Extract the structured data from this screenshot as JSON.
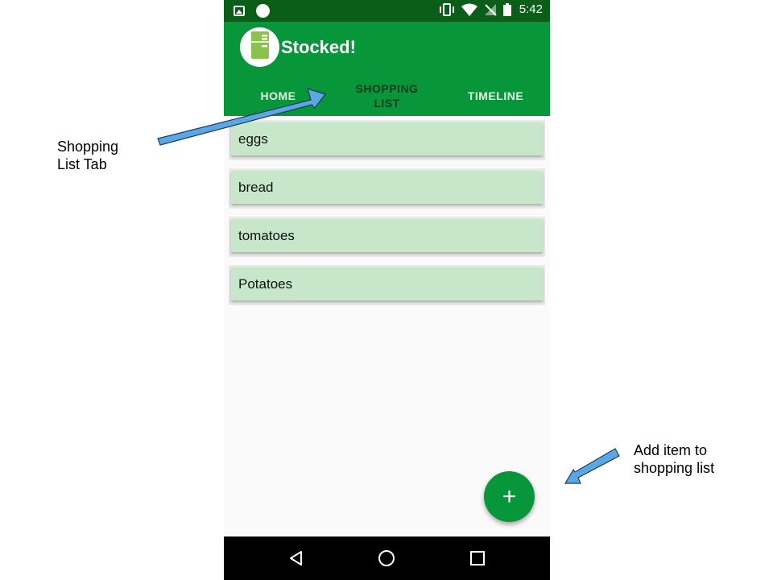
{
  "status_bar": {
    "time": "5:42",
    "left_icons": [
      "image-icon",
      "circle-icon"
    ],
    "right_icons": [
      "vibrate-icon",
      "wifi-icon",
      "no-signal-icon",
      "battery-icon"
    ]
  },
  "app": {
    "title": "Stocked!",
    "logo_icon": "fridge-icon",
    "colors": {
      "primary": "#07963a",
      "status": "#0b5e17",
      "card": "#c8e6c9"
    }
  },
  "tabs": [
    {
      "label": "HOME",
      "active": false
    },
    {
      "label": "SHOPPING\nLIST",
      "active": true
    },
    {
      "label": "TIMELINE",
      "active": false
    }
  ],
  "shopping_list": {
    "items": [
      "eggs",
      "bread",
      "tomatoes",
      "Potatoes"
    ]
  },
  "fab": {
    "icon": "plus-icon",
    "label": "+"
  },
  "nav_bar": {
    "icons": [
      "back-icon",
      "home-icon",
      "recents-icon"
    ]
  },
  "annotations": {
    "tab_note": "Shopping\nList Tab",
    "add_note": "Add item to\nshopping list"
  }
}
